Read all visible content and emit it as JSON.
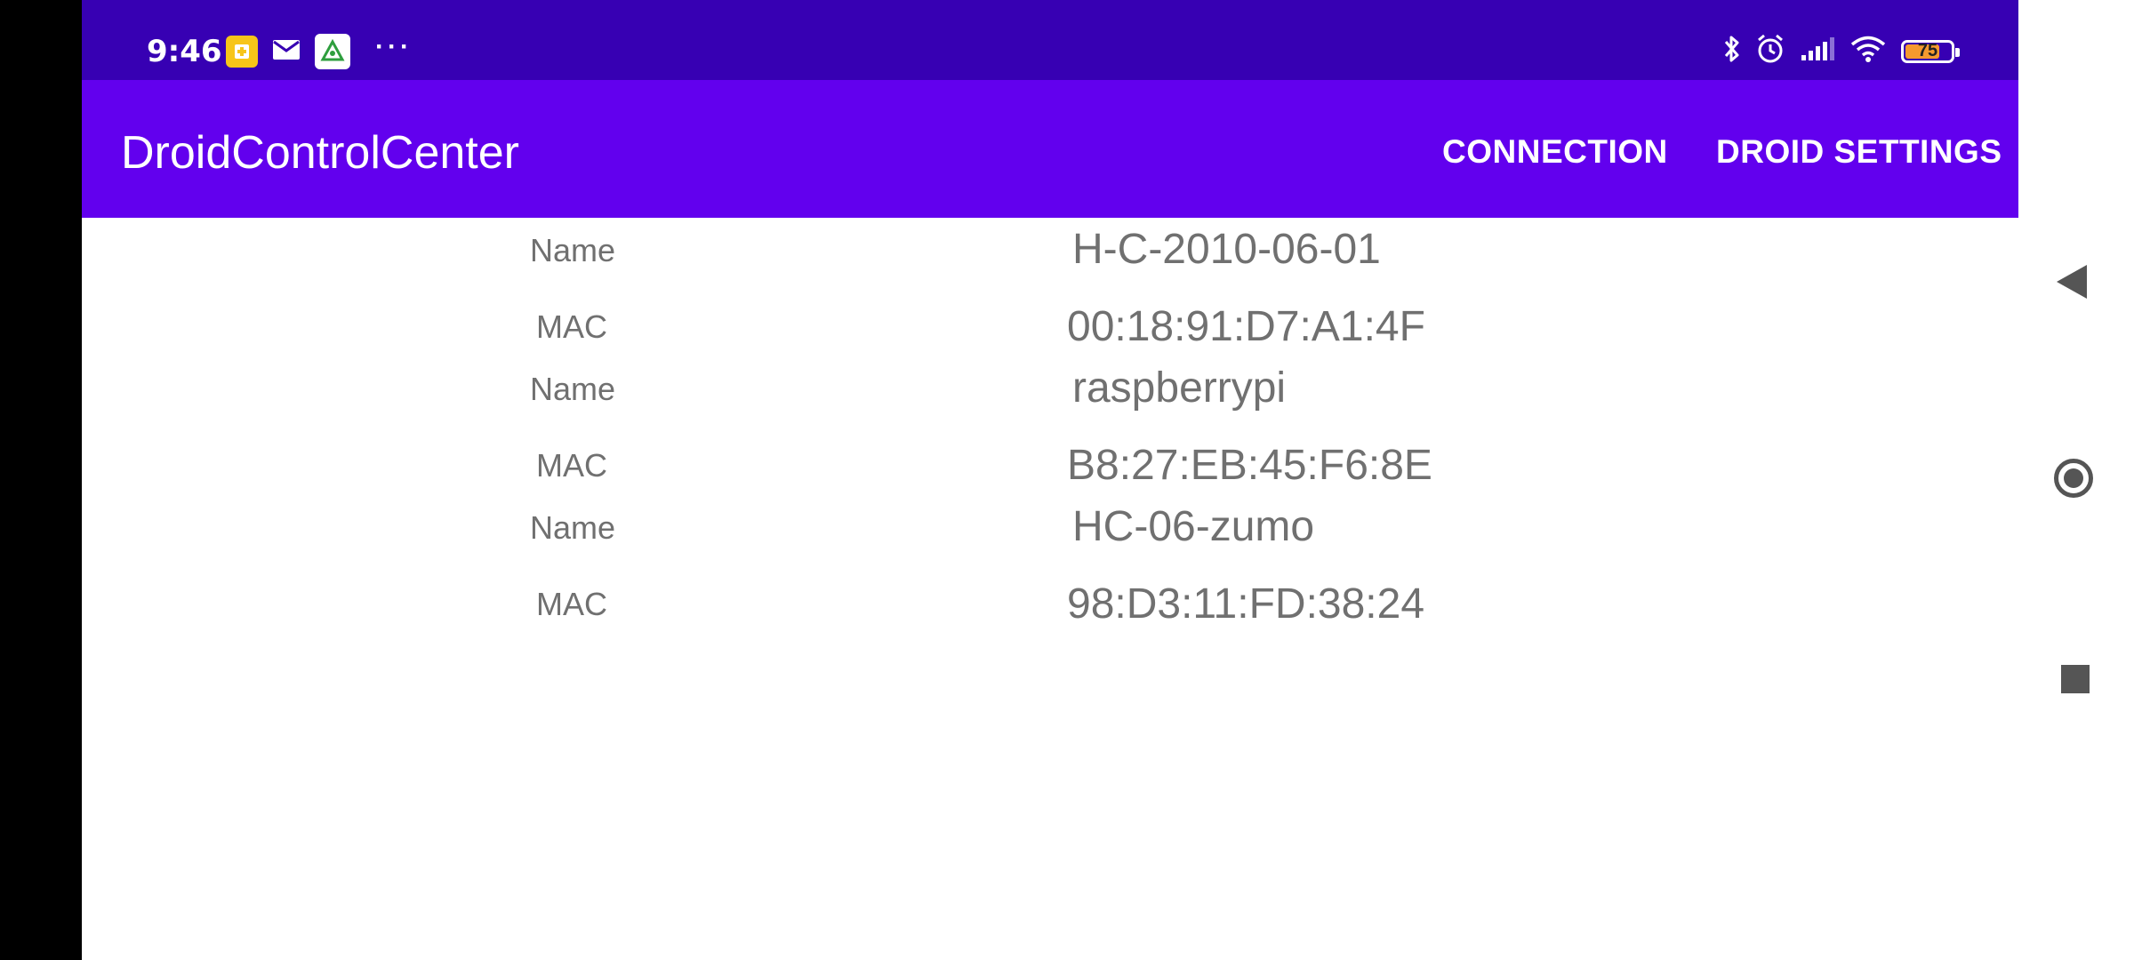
{
  "status_bar": {
    "time": "9:46",
    "left_icons": [
      "sim-toolkit-icon",
      "mail-icon",
      "recycle-app-icon"
    ],
    "overflow_dots": "···",
    "right_icons": [
      "bluetooth-icon",
      "alarm-icon",
      "signal-icon",
      "wifi-icon",
      "battery-icon"
    ],
    "battery_level": "75",
    "battery_fraction": 0.75,
    "battery_color": "#f59a2e"
  },
  "app_bar": {
    "title": "DroidControlCenter",
    "actions": [
      "CONNECTION",
      "DROID SETTINGS"
    ],
    "color": "#6200ee",
    "status_color": "#3700b3"
  },
  "devices": [
    {
      "name_label": "Name",
      "name": "H-C-2010-06-01",
      "mac_label": "MAC",
      "mac": "00:18:91:D7:A1:4F"
    },
    {
      "name_label": "Name",
      "name": "raspberrypi",
      "mac_label": "MAC",
      "mac": "B8:27:EB:45:F6:8E"
    },
    {
      "name_label": "Name",
      "name": "HC-06-zumo",
      "mac_label": "MAC",
      "mac": "98:D3:11:FD:38:24"
    }
  ],
  "nav_bar": {
    "buttons": [
      "back-icon",
      "home-icon",
      "recents-icon"
    ]
  }
}
